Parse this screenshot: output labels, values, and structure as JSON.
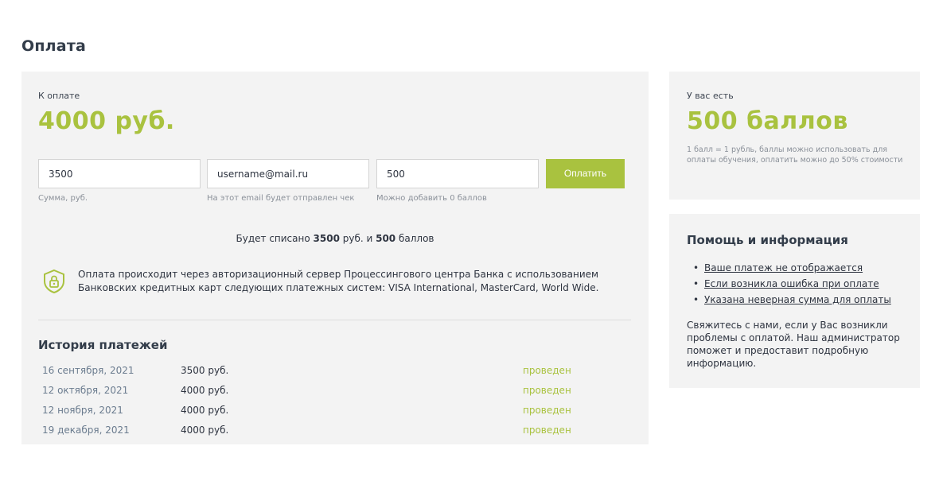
{
  "page": {
    "title": "Оплата"
  },
  "payment": {
    "due_label": "К оплате",
    "due_amount": "4000 руб.",
    "sum_value": "3500",
    "sum_hint": "Сумма, руб.",
    "email_value": "username@mail.ru",
    "email_hint": "На этот email будет отправлен чек",
    "points_value": "500",
    "points_hint": "Можно добавить 0 баллов",
    "pay_button": "Оплатить",
    "deduct_prefix": "Будет списано ",
    "deduct_rub": "3500",
    "deduct_mid": " руб. и ",
    "deduct_points": "500",
    "deduct_suffix": " баллов",
    "secure_text": "Оплата происходит через авторизационный сервер Процессингового центра Банка с использованием Банковских кредитных карт следующих платежных систем: VISA International, MasterCard, World Wide."
  },
  "history": {
    "title": "История платежей",
    "rows": [
      {
        "date": "16 сентября, 2021",
        "amount": "3500 руб.",
        "status": "проведен"
      },
      {
        "date": "12 октября, 2021",
        "amount": "4000 руб.",
        "status": "проведен"
      },
      {
        "date": "12 ноября, 2021",
        "amount": "4000 руб.",
        "status": "проведен"
      },
      {
        "date": "19 декабря, 2021",
        "amount": "4000 руб.",
        "status": "проведен"
      }
    ]
  },
  "points": {
    "label": "У вас есть",
    "amount": "500 баллов",
    "description": "1 балл = 1 рубль, баллы можно использовать для оплаты обучения, оплатить можно до 50% стоимости"
  },
  "help": {
    "title": "Помощь и информация",
    "links": [
      "Ваше платеж не отображается",
      "Если возникла ошибка при оплате",
      "Указана неверная сумма для оплаты"
    ],
    "bullet": "•",
    "text": "Свяжитесь с нами, если у Вас возникли проблемы с оплатой. Наш администратор поможет и предоставит подробную информацию."
  },
  "colors": {
    "accent": "#a9c23f",
    "panel": "#f3f3f3",
    "heading": "#333d4a"
  },
  "icons": {
    "secure": "shield-lock-icon"
  }
}
